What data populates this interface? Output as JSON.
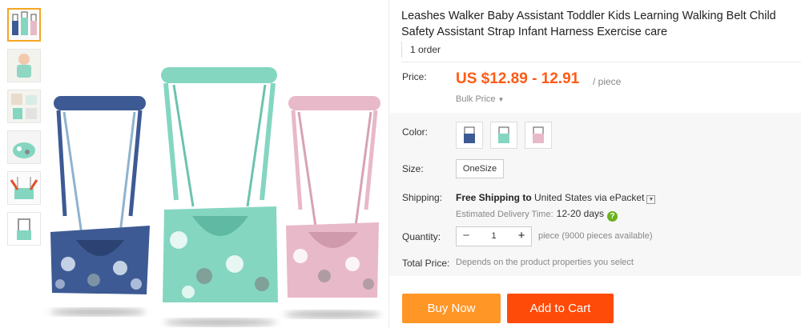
{
  "product": {
    "title": "Leashes Walker Baby Assistant Toddler Kids Learning Walking Belt Child Safety Assistant Strap Infant Harness Exercise care",
    "orders": "1 order"
  },
  "thumbnails": [
    {
      "name": "thumb-three-harnesses",
      "active": true
    },
    {
      "name": "thumb-baby-photo",
      "active": false
    },
    {
      "name": "thumb-harness-details",
      "active": false
    },
    {
      "name": "thumb-harness-closeup",
      "active": false
    },
    {
      "name": "thumb-harness-pair",
      "active": false
    },
    {
      "name": "thumb-single-harness",
      "active": false
    }
  ],
  "gallery": {
    "items": [
      {
        "color": "navy",
        "fill": "#3d5a94",
        "dark": "#2b4272"
      },
      {
        "color": "mint",
        "fill": "#84d6c1",
        "dark": "#5fb9a3"
      },
      {
        "color": "pink",
        "fill": "#e8b9c8",
        "dark": "#cf9aab"
      }
    ]
  },
  "price": {
    "label": "Price:",
    "value": "US $12.89 - 12.91",
    "unit": "/ piece",
    "bulk": "Bulk Price"
  },
  "color": {
    "label": "Color:",
    "swatches": [
      {
        "name": "navy",
        "fill": "#3d5a94"
      },
      {
        "name": "mint",
        "fill": "#84d6c1"
      },
      {
        "name": "pink",
        "fill": "#e8b9c8"
      }
    ]
  },
  "size": {
    "label": "Size:",
    "value": "OneSize"
  },
  "shipping": {
    "label": "Shipping:",
    "free": "Free Shipping to",
    "rest": " United States via ePacket",
    "est_label": "Estimated Delivery Time:",
    "est_days": "12-20 days"
  },
  "quantity": {
    "label": "Quantity:",
    "minus": "−",
    "value": "1",
    "plus": "+",
    "available": "piece (9000 pieces available)"
  },
  "total": {
    "label": "Total Price:",
    "note": "Depends on the product properties you select"
  },
  "buttons": {
    "buy": "Buy Now",
    "cart": "Add to Cart"
  },
  "colors": {
    "accent": "#ff5a14",
    "buy_button": "#ff9626",
    "cart_button": "#ff4b0a"
  }
}
